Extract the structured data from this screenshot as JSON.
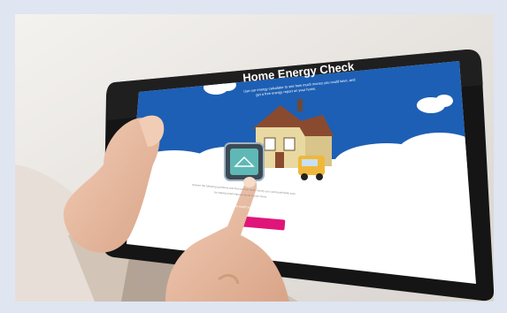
{
  "screen": {
    "title": "Home Energy Check",
    "intro_line1": "Use our energy calculator to see how much money you could save, and",
    "intro_line2": "get a free energy report on your home.",
    "body_line1": "Answer the following questions and find out how much money you could potentially save",
    "body_line2": "by making small improvements to your home.",
    "cta_label": "Find out how much you can save"
  },
  "colors": {
    "sky": "#1d5fb4",
    "cta": "#e0157a",
    "frame": "#dfe5f1"
  },
  "icons": [
    "house-illustration",
    "thermostat-illustration",
    "van-illustration",
    "cloud-shape"
  ]
}
